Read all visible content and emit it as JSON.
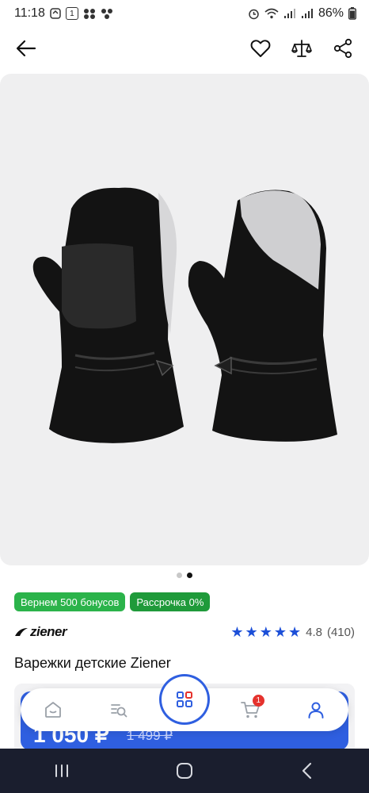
{
  "status_bar": {
    "time": "11:18",
    "battery": "86%"
  },
  "badges": [
    {
      "label": "Вернем 500 бонусов"
    },
    {
      "label": "Рассрочка 0%"
    }
  ],
  "brand": {
    "logo_text": "ziener"
  },
  "rating": {
    "value": "4.8",
    "count": "(410)",
    "stars": 5
  },
  "product": {
    "title": "Варежки детские Ziener"
  },
  "price": {
    "current": "1 050 ₽",
    "old": "1 499 ₽"
  },
  "carousel": {
    "total": 2,
    "active_index": 2
  },
  "bottom_nav": {
    "cart_count": "1"
  },
  "colors": {
    "accent": "#2f5fe0",
    "badge_green": "#2bb34a",
    "star_blue": "#1c4fd8",
    "cart_red": "#e5322d"
  }
}
